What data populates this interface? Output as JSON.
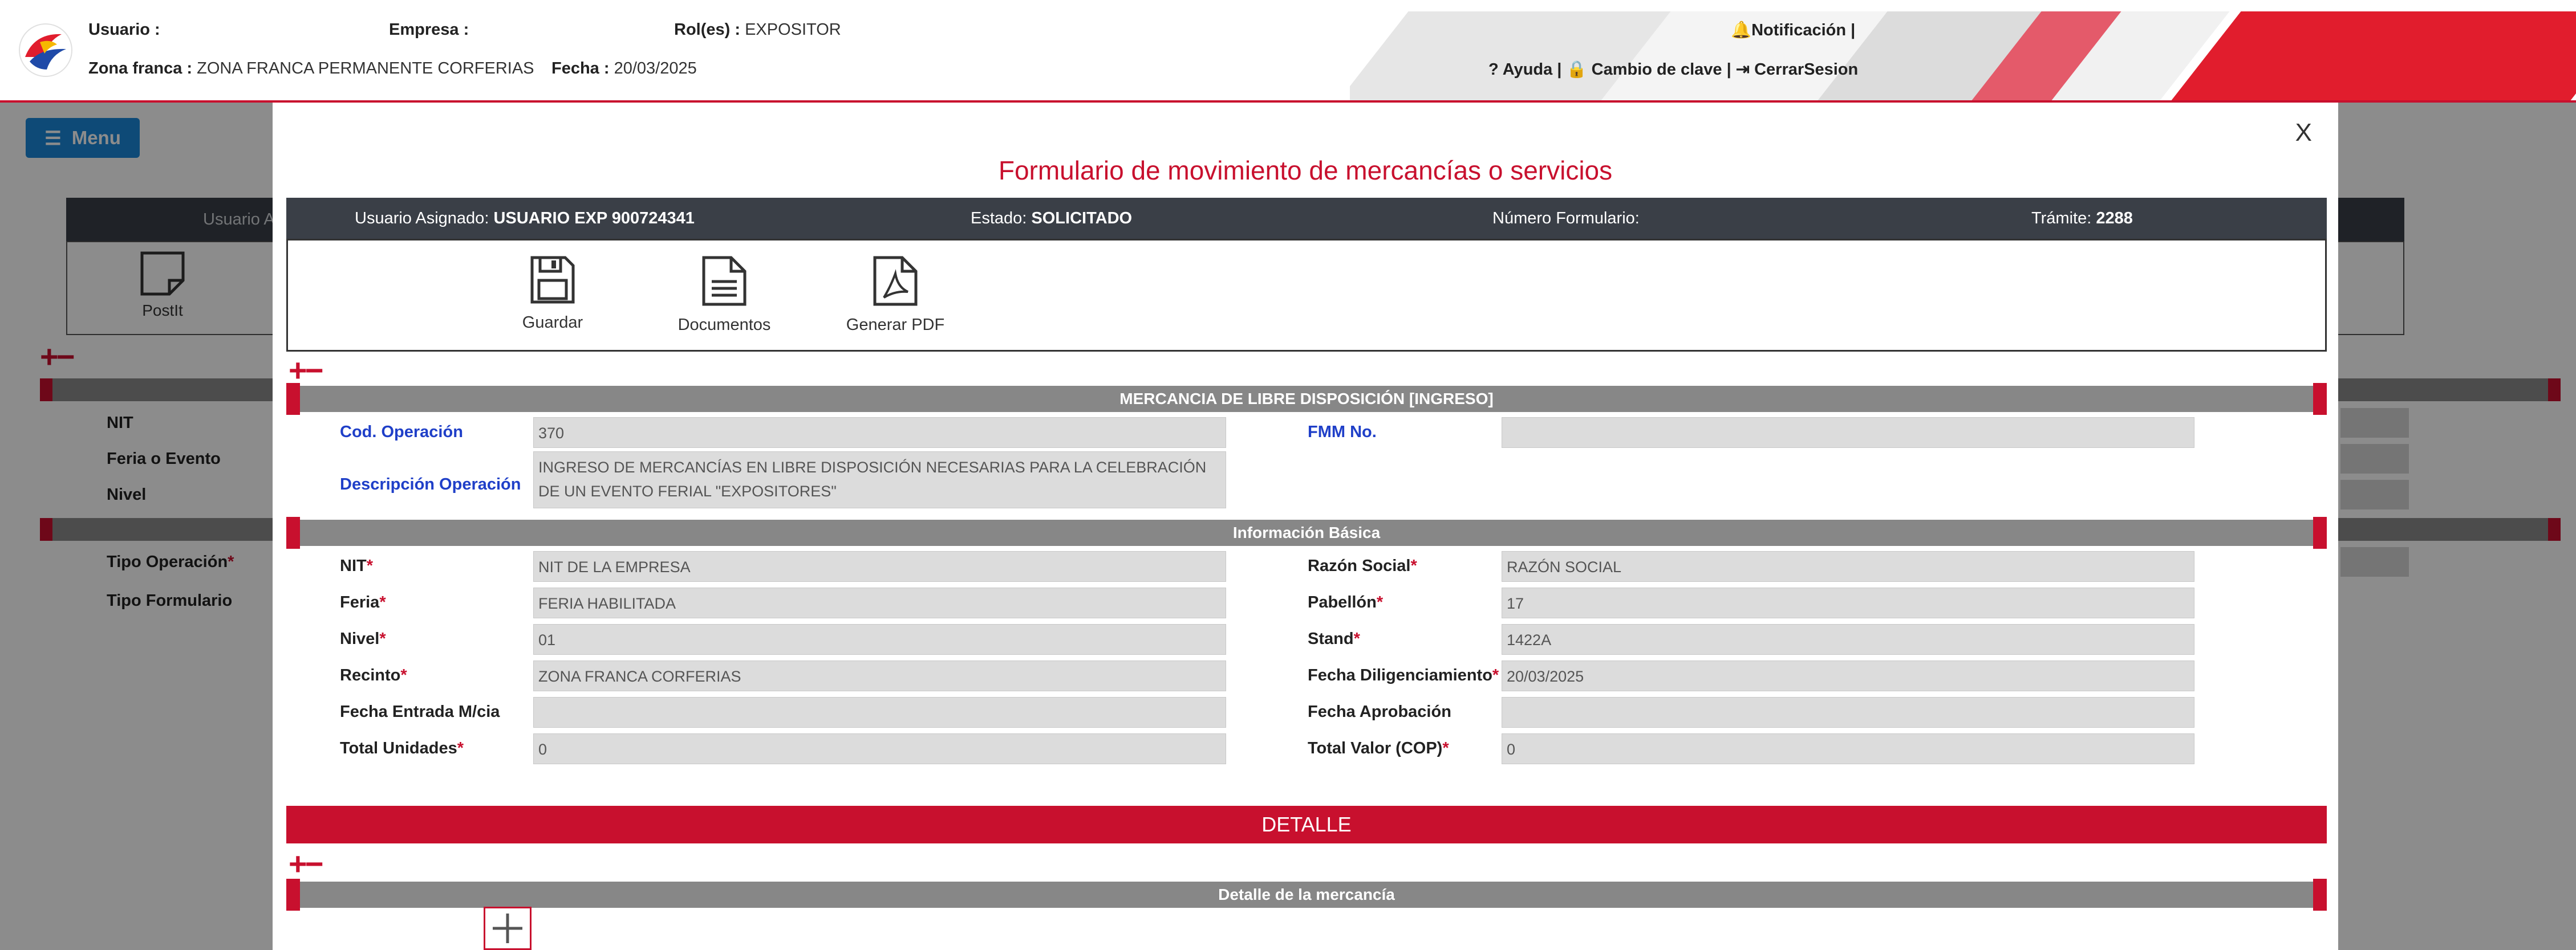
{
  "header": {
    "usuario_label": "Usuario :",
    "empresa_label": "Empresa :",
    "roles_label": "Rol(es) :",
    "roles_value": "EXPOSITOR",
    "zona_label": "Zona franca :",
    "zona_value": "ZONA FRANCA PERMANENTE CORFERIAS",
    "fecha_label": "Fecha :",
    "fecha_value": "20/03/2025",
    "notificacion": "Notificación |",
    "links": "? Ayuda | 🔒 Cambio de clave | ⇥ CerrarSesion",
    "brand_color": "#c8102e"
  },
  "background": {
    "menu_label": "Menu",
    "tab_label": "Usuario A",
    "postit_label": "PostIt",
    "labels": [
      "NIT",
      "Feria o Evento",
      "Nivel"
    ],
    "tipo_operacion_label": "Tipo Operación",
    "tipo_formulario_label": "Tipo Formulario"
  },
  "modal": {
    "close_label": "X",
    "title": "Formulario de movimiento de mercancías o servicios",
    "info_bar": {
      "usuario_asignado_label": "Usuario Asignado:",
      "usuario_asignado_value": "USUARIO EXP 900724341",
      "estado_label": "Estado:",
      "estado_value": "SOLICITADO",
      "numero_formulario_label": "Número Formulario:",
      "tramite_label": "Trámite:",
      "tramite_value": "2288"
    },
    "actions": [
      {
        "label": "Guardar",
        "icon": "save-icon"
      },
      {
        "label": "Documentos",
        "icon": "document-icon"
      },
      {
        "label": "Generar PDF",
        "icon": "pdf-icon"
      }
    ],
    "section_mercancia": "MERCANCIA DE LIBRE DISPOSICIÓN [INGRESO]",
    "cod_operacion_label": "Cod. Operación",
    "cod_operacion_value": "370",
    "fmm_label": "FMM No.",
    "fmm_value": "",
    "descripcion_label": "Descripción Operación",
    "descripcion_value": "INGRESO DE MERCANCÍAS EN LIBRE DISPOSICIÓN NECESARIAS PARA LA CELEBRACIÓN DE UN EVENTO FERIAL \"EXPOSITORES\"",
    "section_basica": "Información Básica",
    "fields_left": [
      {
        "label": "NIT",
        "required": "*",
        "value": "NIT DE LA EMPRESA"
      },
      {
        "label": "Feria",
        "required": "*",
        "value": "FERIA HABILITADA"
      },
      {
        "label": "Nivel",
        "required": "*",
        "value": "01"
      },
      {
        "label": "Recinto",
        "required": "*",
        "value": "ZONA FRANCA CORFERIAS"
      },
      {
        "label": "Fecha Entrada M/cia",
        "required": "",
        "value": ""
      },
      {
        "label": "Total Unidades",
        "required": "*",
        "value": "0"
      }
    ],
    "fields_right": [
      {
        "label": "Razón Social",
        "required": "*",
        "value": "RAZÓN SOCIAL"
      },
      {
        "label": "Pabellón",
        "required": "*",
        "value": "17"
      },
      {
        "label": "Stand",
        "required": "*",
        "value": "1422A"
      },
      {
        "label": "Fecha Diligenciamiento",
        "required": "*",
        "value": "20/03/2025"
      },
      {
        "label": "Fecha Aprobación",
        "required": "",
        "value": ""
      },
      {
        "label": "Total Valor (COP)",
        "required": "*",
        "value": "0"
      }
    ],
    "detalle_label": "DETALLE",
    "section_detalle": "Detalle de la mercancía"
  }
}
